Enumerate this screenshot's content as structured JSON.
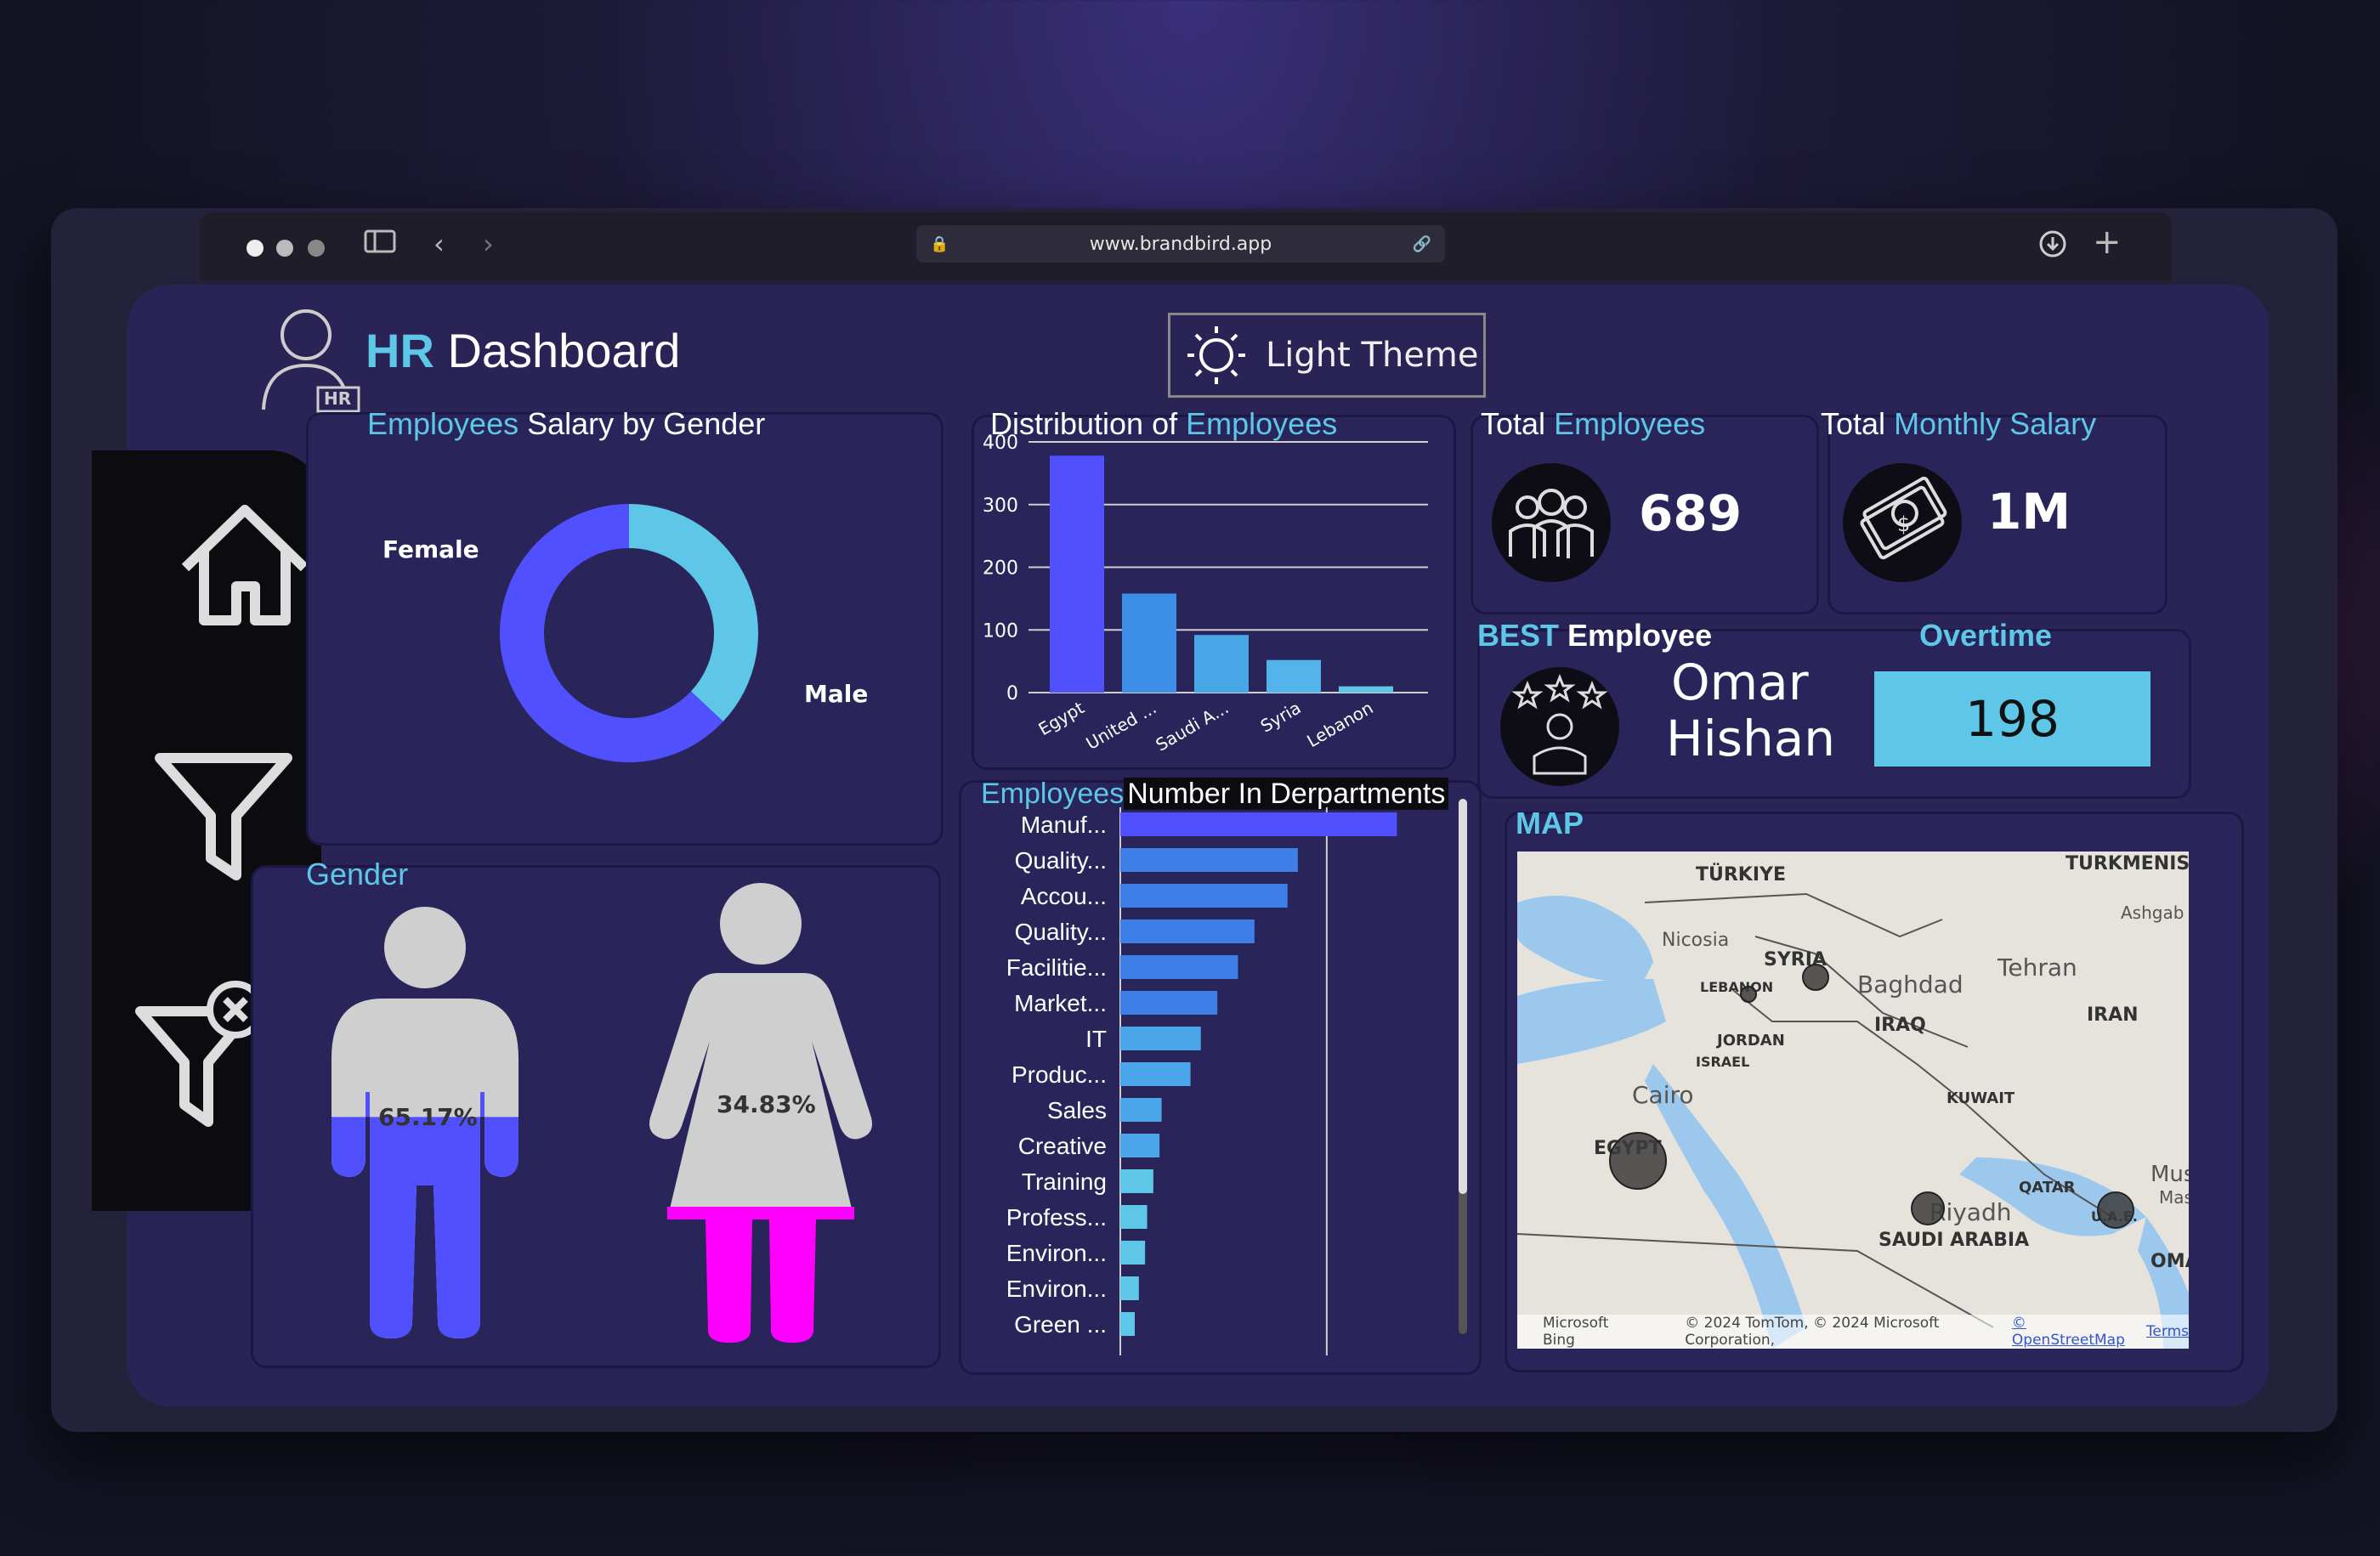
{
  "browser": {
    "url": "www.brandbird.app"
  },
  "header": {
    "title_accent": "HR",
    "title_rest": "Dashboard",
    "avatar_badge": "HR",
    "theme_button": "Light Theme"
  },
  "nav": {
    "items": [
      "home-icon",
      "filter-icon",
      "clear-filter-icon"
    ]
  },
  "salary_by_gender": {
    "title_accent": "Employees",
    "title_rest": "Salary by Gender",
    "labels": {
      "female": "Female",
      "male": "Male"
    }
  },
  "gender": {
    "title": "Gender",
    "male_pct": "65.17%",
    "female_pct": "34.83%"
  },
  "distribution": {
    "title_rest": "Distribution of",
    "title_accent": "Employees"
  },
  "departments": {
    "title_accent": "Employees",
    "title_rest": "Number In Derpartments"
  },
  "kpis": {
    "total_employees": {
      "title_rest": "Total",
      "title_accent": "Employees",
      "value": "689"
    },
    "total_salary": {
      "title_rest": "Total",
      "title_accent": "Monthly Salary",
      "value": "1M"
    }
  },
  "best_employee": {
    "title_accent": "BEST",
    "title_rest": "Employee",
    "first_name": "Omar",
    "last_name": "Hishan"
  },
  "overtime": {
    "title": "Overtime",
    "value": "198"
  },
  "map": {
    "title": "MAP",
    "countries": [
      "TÜRKIYE",
      "SYRIA",
      "LEBANON",
      "JORDAN",
      "ISRAEL",
      "IRAQ",
      "IRAN",
      "KUWAIT",
      "QATAR",
      "SAUDI ARABIA",
      "EGYPT",
      "U.A.E.",
      "OMAN",
      "TURKMENIST"
    ],
    "cities": [
      "Nicosia",
      "Baghdad",
      "Tehran",
      "Cairo",
      "Riyadh",
      "Ashgab",
      "Musca",
      "Masca"
    ],
    "footer_brand": "Microsoft Bing",
    "copyright": "© 2024 TomTom, © 2024 Microsoft Corporation,",
    "osm_link": "© OpenStreetMap",
    "terms_link": "Terms"
  },
  "colors": {
    "accent": "#5ec6e6",
    "male": "#5050ff",
    "female": "#ff00ff",
    "figure": "#cfcfcf",
    "bar": "#4b5bf0"
  },
  "chart_data": [
    {
      "type": "pie",
      "title": "Employees Salary by Gender",
      "categories": [
        "Female",
        "Male"
      ],
      "values": [
        37,
        63
      ]
    },
    {
      "type": "bar",
      "title": "Distribution of Employees",
      "categories": [
        "Egypt",
        "United ...",
        "Saudi A...",
        "Syria",
        "Lebanon"
      ],
      "values": [
        378,
        158,
        92,
        52,
        10
      ],
      "ylim": [
        0,
        400
      ],
      "yticks": [
        0,
        100,
        200,
        300,
        400
      ],
      "grid": true
    },
    {
      "type": "bar",
      "orientation": "horizontal",
      "title": "Employees Number In Derpartments",
      "categories": [
        "Manuf...",
        "Quality...",
        "Accou...",
        "Quality...",
        "Facilitie...",
        "Market...",
        "IT",
        "Produc...",
        "Sales",
        "Creative",
        "Training",
        "Profess...",
        "Environ...",
        "Environ...",
        "Green ..."
      ],
      "values": [
        134,
        86,
        81,
        65,
        57,
        47,
        39,
        34,
        20,
        19,
        16,
        13,
        12,
        9,
        7
      ],
      "xticks": [
        0,
        100
      ],
      "xlim": [
        0,
        140
      ]
    }
  ]
}
